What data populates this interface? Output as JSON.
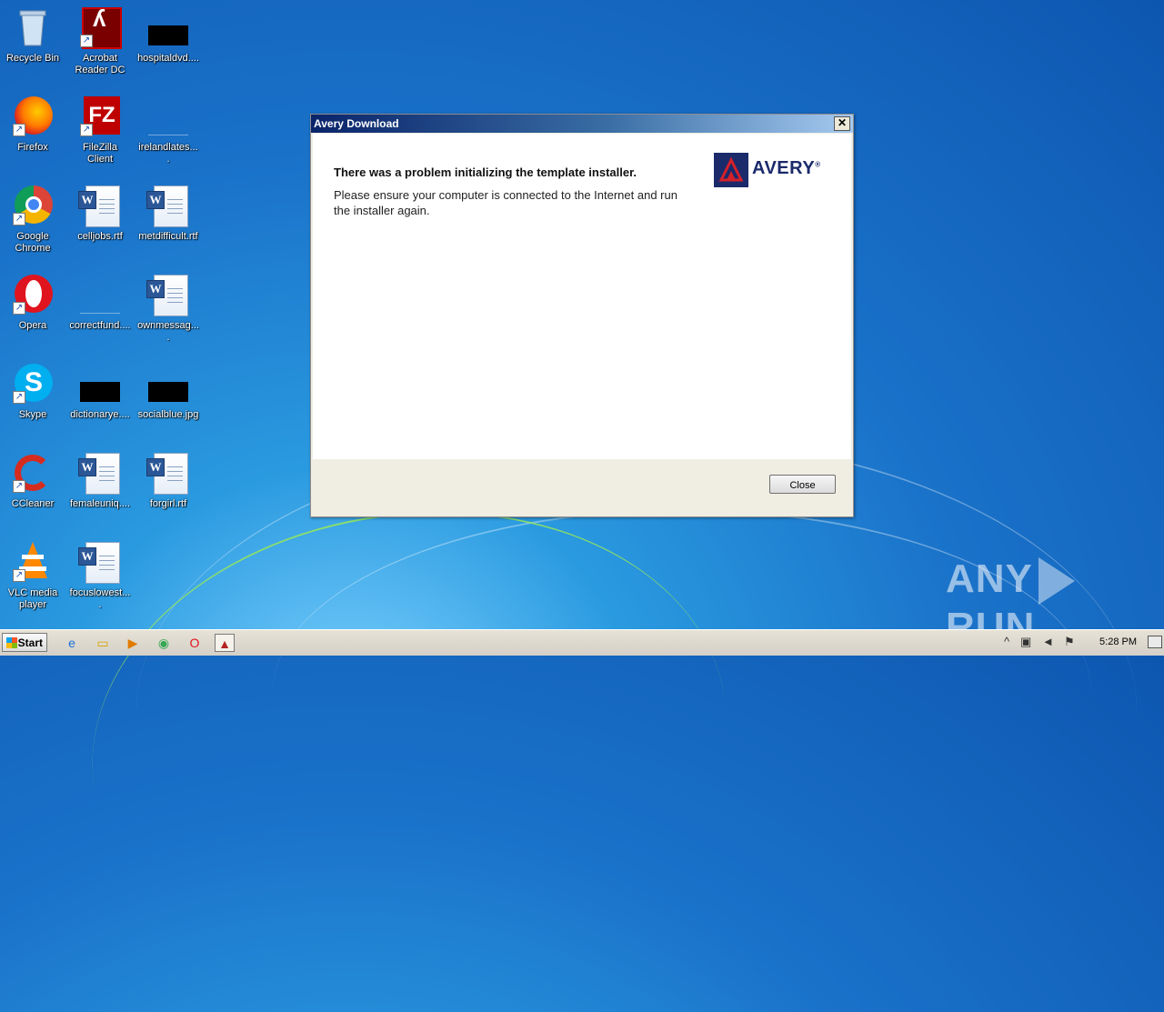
{
  "desktop": {
    "icons": [
      {
        "label": "Recycle Bin",
        "kind": "recycle-bin"
      },
      {
        "label": "Acrobat Reader DC",
        "kind": "acrobat"
      },
      {
        "label": "hospitaldvd....",
        "kind": "black-image"
      },
      {
        "label": "Firefox",
        "kind": "firefox"
      },
      {
        "label": "FileZilla Client",
        "kind": "filezilla"
      },
      {
        "label": "irelandlates....",
        "kind": "blank"
      },
      {
        "label": "Google Chrome",
        "kind": "chrome"
      },
      {
        "label": "celljobs.rtf",
        "kind": "word-doc"
      },
      {
        "label": "metdifficult.rtf",
        "kind": "word-doc"
      },
      {
        "label": "Opera",
        "kind": "opera"
      },
      {
        "label": "correctfund....",
        "kind": "blank"
      },
      {
        "label": "ownmessag....",
        "kind": "word-doc"
      },
      {
        "label": "Skype",
        "kind": "skype"
      },
      {
        "label": "dictionarye....",
        "kind": "black-image"
      },
      {
        "label": "socialblue.jpg",
        "kind": "black-image"
      },
      {
        "label": "CCleaner",
        "kind": "ccleaner"
      },
      {
        "label": "femaleuniq....",
        "kind": "word-doc"
      },
      {
        "label": "forgirl.rtf",
        "kind": "word-doc"
      },
      {
        "label": "VLC media player",
        "kind": "vlc"
      },
      {
        "label": "focuslowest....",
        "kind": "word-doc"
      }
    ]
  },
  "dialog": {
    "title": "Avery Download",
    "close_glyph": "✕",
    "heading": "There was a problem initializing the template installer.",
    "body": "Please ensure your computer is connected to the Internet and run the installer again.",
    "logo_text": "AVERY",
    "logo_mark": "®",
    "close_button": "Close",
    "brand_color": "#1b2a6b",
    "accent_red": "#d4202a"
  },
  "watermark": {
    "left": "ANY",
    "right": "RUN"
  },
  "taskbar": {
    "start_label": "Start",
    "apps": [
      {
        "name": "internet-explorer-icon",
        "glyph": "e"
      },
      {
        "name": "explorer-folder-icon",
        "glyph": "▭"
      },
      {
        "name": "media-player-icon",
        "glyph": "▶"
      },
      {
        "name": "chrome-icon",
        "glyph": "◉"
      },
      {
        "name": "opera-icon",
        "glyph": "O"
      },
      {
        "name": "avery-task-icon",
        "glyph": "▲"
      }
    ],
    "tray": {
      "chevron": "^",
      "time": "5:28 PM"
    }
  }
}
